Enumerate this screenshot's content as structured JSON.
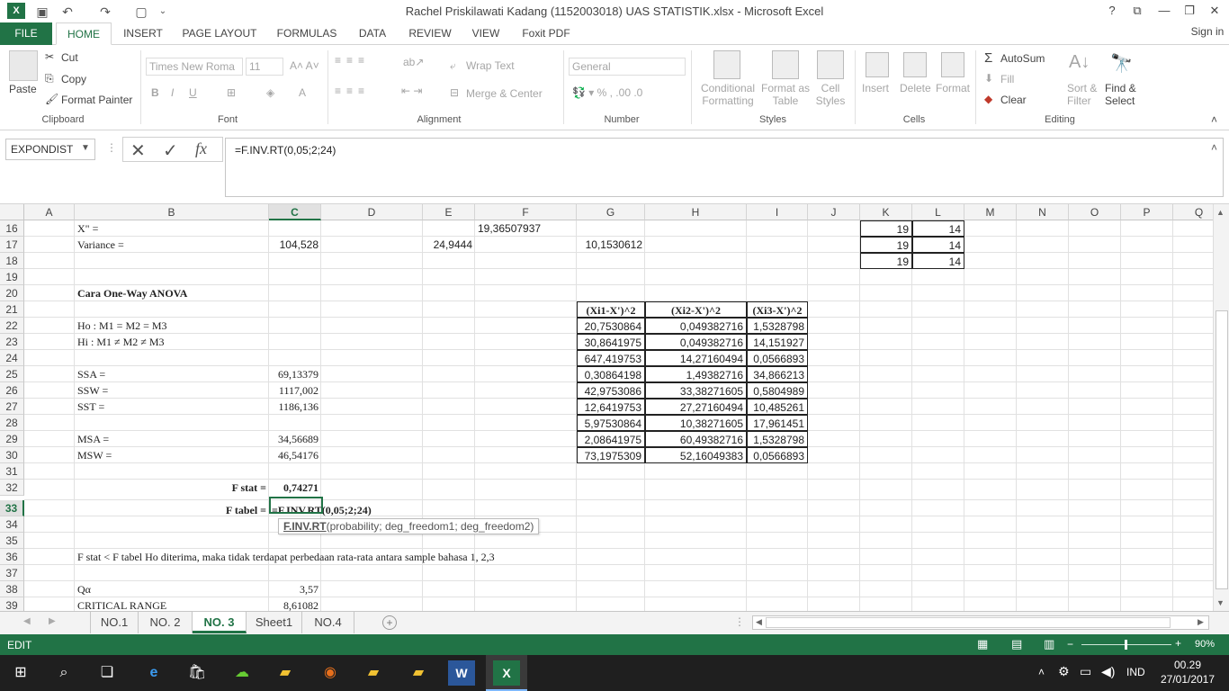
{
  "window": {
    "title": "Rachel Priskilawati Kadang (1152003018) UAS STATISTIK.xlsx - Microsoft Excel",
    "help": "?",
    "signin": "Sign in"
  },
  "tabs": [
    "FILE",
    "HOME",
    "INSERT",
    "PAGE LAYOUT",
    "FORMULAS",
    "DATA",
    "REVIEW",
    "VIEW",
    "Foxit PDF"
  ],
  "ribbon": {
    "clipboard": {
      "paste": "Paste",
      "cut": "Cut",
      "copy": "Copy",
      "format_painter": "Format Painter",
      "label": "Clipboard"
    },
    "font": {
      "name": "Times New Roma",
      "size": "11",
      "bold": "B",
      "italic": "I",
      "underline": "U",
      "label": "Font"
    },
    "alignment": {
      "wrap": "Wrap Text",
      "merge": "Merge & Center",
      "label": "Alignment"
    },
    "number": {
      "format": "General",
      "label": "Number"
    },
    "styles": {
      "cond": "Conditional",
      "cond2": "Formatting",
      "table": "Format as",
      "table2": "Table",
      "cell": "Cell",
      "cell2": "Styles",
      "label": "Styles"
    },
    "cells": {
      "insert": "Insert",
      "delete": "Delete",
      "format": "Format",
      "label": "Cells"
    },
    "editing": {
      "autosum": "AutoSum",
      "fill": "Fill",
      "clear": "Clear",
      "sort": "Sort &",
      "sort2": "Filter",
      "find": "Find &",
      "find2": "Select",
      "label": "Editing"
    }
  },
  "formula": {
    "namebox": "EXPONDIST",
    "content": "=F.INV.RT(0,05;2;24)"
  },
  "columns": [
    "A",
    "B",
    "C",
    "D",
    "E",
    "F",
    "G",
    "H",
    "I",
    "J",
    "K",
    "L",
    "M",
    "N",
    "O",
    "P",
    "Q"
  ],
  "rows": [
    "16",
    "17",
    "18",
    "19",
    "20",
    "21",
    "22",
    "23",
    "24",
    "25",
    "26",
    "27",
    "28",
    "29",
    "30",
    "31",
    "32",
    "33",
    "34",
    "35",
    "36",
    "37",
    "38",
    "39"
  ],
  "cells": {
    "b16": "X\" =",
    "f16": "19,36507937",
    "b17": "Variance =",
    "c17": "104,528",
    "e17": "24,9444",
    "g17": "10,1530612",
    "k16": "19",
    "l16": "14",
    "k17": "19",
    "l17": "14",
    "k18": "19",
    "l18": "14",
    "b20": "Cara One-Way ANOVA",
    "b22": "Ho : M1 = M2 = M3",
    "b23": "Hi : M1 ≠ M2  ≠ M3",
    "b25": "SSA =",
    "c25": "69,13379",
    "b26": "SSW =",
    "c26": "1117,002",
    "b27": "SST =",
    "c27": "1186,136",
    "b29": "MSA =",
    "c29": "34,56689",
    "b30": "MSW =",
    "c30": "46,54176",
    "b32": "F stat =",
    "c32": "0,74271",
    "b33": "F tabel =",
    "c33": "=F.INV.RT(0,05;2;24)",
    "b36": "F stat < F tabel Ho diterima, maka tidak terdapat perbedaan rata-rata antara sample bahasa 1, 2,3",
    "b38": "Qα",
    "c38": "3,57",
    "b39": "CRITICAL RANGE",
    "c39": "8,61082"
  },
  "table": {
    "headers": [
      "(Xi1-X')^2",
      "(Xi2-X')^2",
      "(Xi3-X')^2"
    ],
    "rows": [
      [
        "20,7530864",
        "0,049382716",
        "1,5328798"
      ],
      [
        "30,8641975",
        "0,049382716",
        "14,151927"
      ],
      [
        "647,419753",
        "14,27160494",
        "0,0566893"
      ],
      [
        "0,30864198",
        "1,49382716",
        "34,866213"
      ],
      [
        "42,9753086",
        "33,38271605",
        "0,5804989"
      ],
      [
        "12,6419753",
        "27,27160494",
        "10,485261"
      ],
      [
        "5,97530864",
        "10,38271605",
        "17,961451"
      ],
      [
        "2,08641975",
        "60,49382716",
        "1,5328798"
      ],
      [
        "73,1975309",
        "52,16049383",
        "0,0566893"
      ]
    ]
  },
  "tooltip": {
    "fn": "F.INV.RT",
    "args": "(probability; deg_freedom1; deg_freedom2)"
  },
  "sheets": [
    "NO.1",
    "NO. 2",
    "NO. 3",
    "Sheet1",
    "NO.4"
  ],
  "status": {
    "mode": "EDIT",
    "zoom": "90%"
  },
  "taskbar": {
    "lang": "IND",
    "time": "00.29",
    "date": "27/01/2017"
  }
}
